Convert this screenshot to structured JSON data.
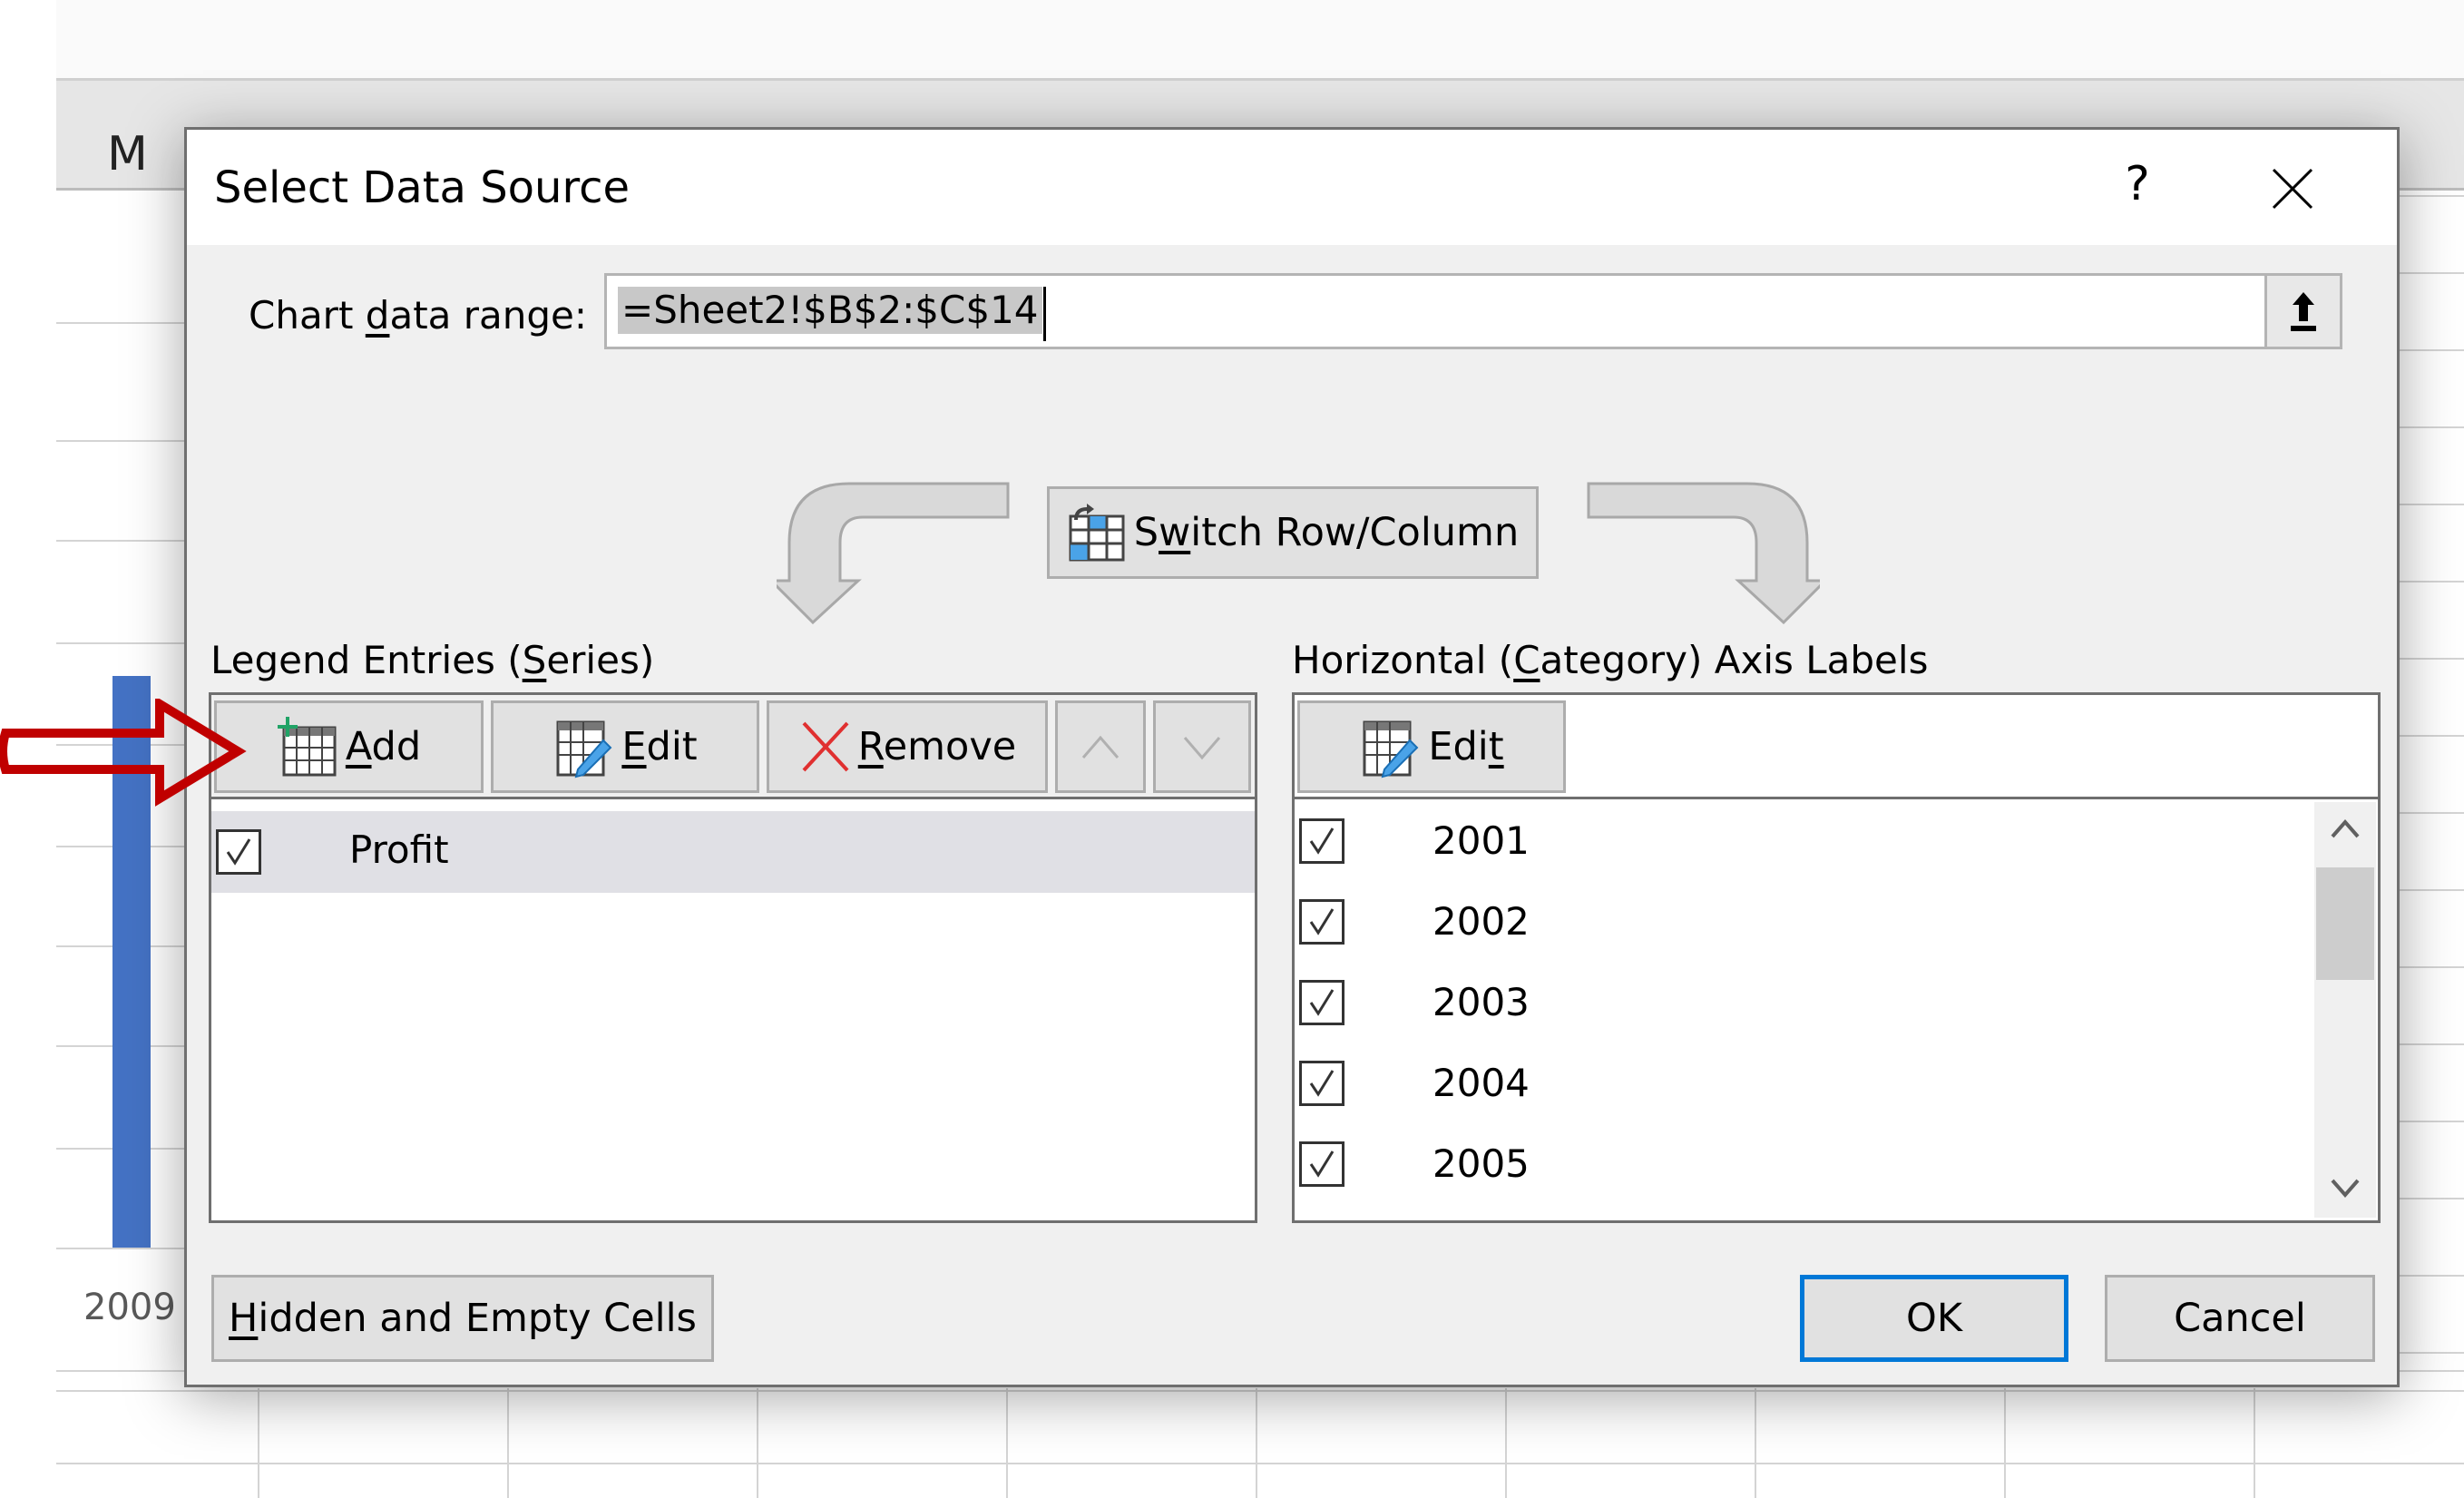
{
  "background": {
    "column_header": "M",
    "axis_label": "2009",
    "bar_color": "#4472c4"
  },
  "dialog": {
    "title": "Select Data Source",
    "help_label": "?",
    "close_icon": "close-icon",
    "chart_data_range": {
      "label_pre": "Chart ",
      "label_accel": "d",
      "label_post": "ata range:",
      "value": "=Sheet2!$B$2:$C$14",
      "collapse_icon": "collapse-dialog-icon"
    },
    "switch_row_column": {
      "label_pre": "S",
      "label_accel": "w",
      "label_post": "itch Row/Column",
      "icon": "switch-row-column-icon"
    },
    "legend_entries": {
      "title_pre": "Legend Entries (",
      "title_accel": "S",
      "title_post": "eries)",
      "buttons": {
        "add": {
          "accel": "A",
          "rest": "dd",
          "icon": "add-series-icon"
        },
        "edit": {
          "accel": "E",
          "rest": "dit",
          "icon": "edit-series-icon"
        },
        "remove": {
          "accel": "R",
          "rest": "emove",
          "icon": "remove-icon"
        },
        "move_up": {
          "icon": "chevron-up-icon",
          "enabled": false
        },
        "move_down": {
          "icon": "chevron-down-icon",
          "enabled": false
        }
      },
      "series": [
        {
          "name": "Profit",
          "checked": true,
          "selected": true
        }
      ]
    },
    "axis_labels": {
      "title_pre": "Horizontal (",
      "title_accel": "C",
      "title_post": "ategory) Axis Labels",
      "edit_button": {
        "pre": "Edi",
        "accel": "t",
        "icon": "edit-axis-labels-icon"
      },
      "categories": [
        {
          "label": "2001",
          "checked": true
        },
        {
          "label": "2002",
          "checked": true
        },
        {
          "label": "2003",
          "checked": true
        },
        {
          "label": "2004",
          "checked": true
        },
        {
          "label": "2005",
          "checked": true
        }
      ]
    },
    "hidden_empty_cells": {
      "accel": "H",
      "rest": "idden and Empty Cells"
    },
    "ok_label": "OK",
    "cancel_label": "Cancel",
    "accent_color": "#0078d7"
  },
  "annotation": {
    "arrow_color": "#c00000",
    "points_to": "add-button"
  }
}
